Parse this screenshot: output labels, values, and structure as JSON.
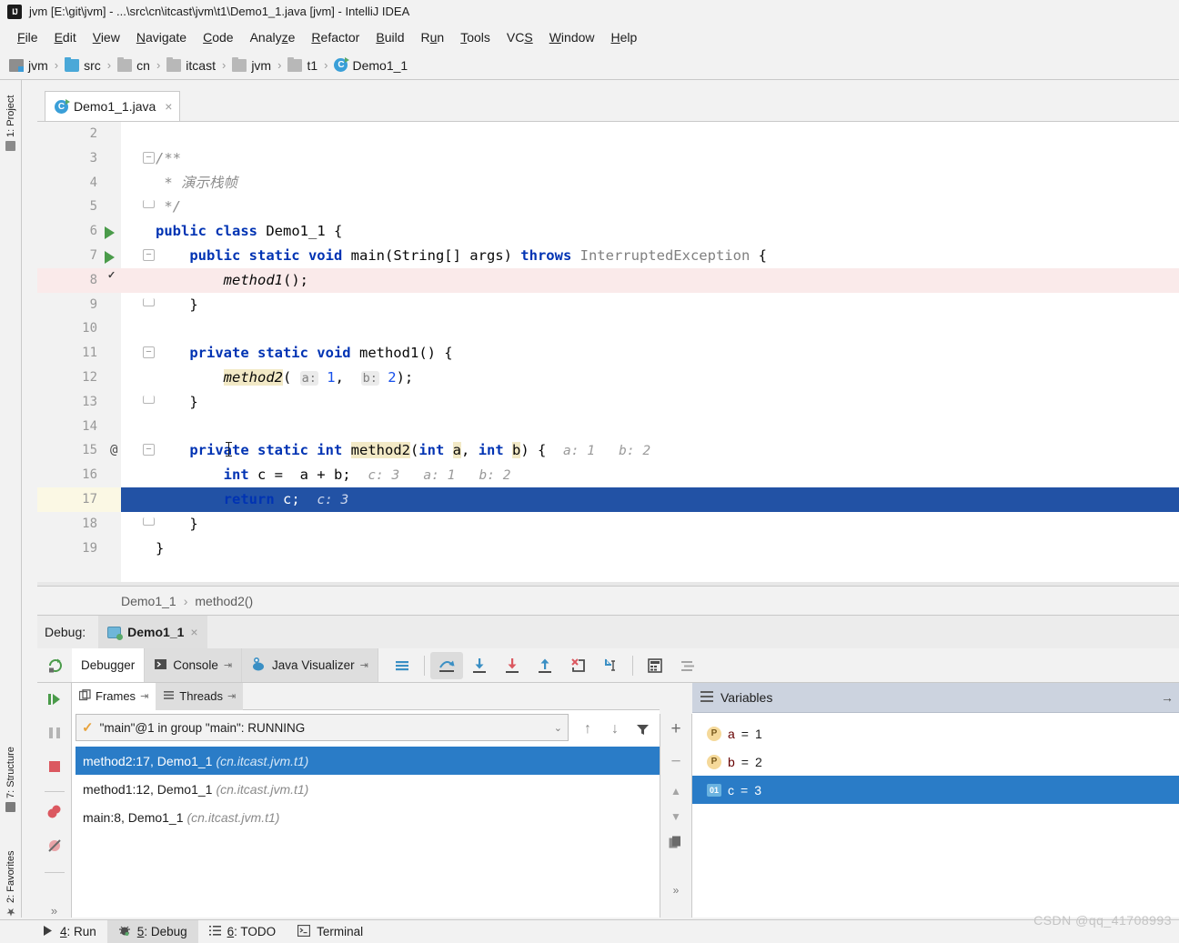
{
  "window": {
    "title": "jvm [E:\\git\\jvm] - ...\\src\\cn\\itcast\\jvm\\t1\\Demo1_1.java [jvm] - IntelliJ IDEA",
    "logo": "intellij-idea-logo"
  },
  "menu": [
    {
      "label": "File",
      "mnemonic": "F"
    },
    {
      "label": "Edit",
      "mnemonic": "E"
    },
    {
      "label": "View",
      "mnemonic": "V"
    },
    {
      "label": "Navigate",
      "mnemonic": "N"
    },
    {
      "label": "Code",
      "mnemonic": "C"
    },
    {
      "label": "Analyze",
      "mnemonic": "z"
    },
    {
      "label": "Refactor",
      "mnemonic": "R"
    },
    {
      "label": "Build",
      "mnemonic": "B"
    },
    {
      "label": "Run",
      "mnemonic": "u"
    },
    {
      "label": "Tools",
      "mnemonic": "T"
    },
    {
      "label": "VCS",
      "mnemonic": "S"
    },
    {
      "label": "Window",
      "mnemonic": "W"
    },
    {
      "label": "Help",
      "mnemonic": "H"
    }
  ],
  "breadcrumb": [
    {
      "label": "jvm",
      "icon": "module-icon"
    },
    {
      "label": "src",
      "icon": "source-folder-icon"
    },
    {
      "label": "cn",
      "icon": "package-icon"
    },
    {
      "label": "itcast",
      "icon": "package-icon"
    },
    {
      "label": "jvm",
      "icon": "package-icon"
    },
    {
      "label": "t1",
      "icon": "package-icon"
    },
    {
      "label": "Demo1_1",
      "icon": "java-class-icon"
    }
  ],
  "left_rail": [
    {
      "label": "1: Project",
      "num": "1",
      "name": "Project",
      "icon": "project-folder-icon"
    },
    {
      "label": "7: Structure",
      "num": "7",
      "name": "Structure",
      "icon": "structure-icon"
    },
    {
      "label": "2: Favorites",
      "num": "2",
      "name": "Favorites",
      "icon": "star-icon"
    }
  ],
  "editor": {
    "tab": {
      "label": "Demo1_1.java",
      "icon": "java-class-run-icon",
      "close": "×"
    },
    "breadcrumb": {
      "class": "Demo1_1",
      "separator": "›",
      "method": "method2()"
    },
    "lines": [
      {
        "n": "2",
        "html": "",
        "state": "normal"
      },
      {
        "n": "3",
        "html": "<span class='cmt'>/**</span>",
        "state": "normal",
        "fold": "minus"
      },
      {
        "n": "4",
        "html": "<span class='cmt'> * 演示栈帧</span>",
        "state": "normal"
      },
      {
        "n": "5",
        "html": "<span class='cmt'> */</span>",
        "state": "normal",
        "fold": "end"
      },
      {
        "n": "6",
        "html": "<span class='kw'>public class</span> <span class='cls'>Demo1_1</span> {",
        "state": "normal",
        "gutter": "run"
      },
      {
        "n": "7",
        "html": "    <span class='kw'>public static void</span> <span class='mth'>main</span>(String[] args) <span class='kw'>throws</span> <span class='exc'>InterruptedException</span> {",
        "state": "normal",
        "gutter": "run",
        "fold": "minus"
      },
      {
        "n": "8",
        "html": "        <span class='ital'>method1</span>();",
        "state": "breakpoint",
        "gutter": "breakpoint"
      },
      {
        "n": "9",
        "html": "    }",
        "state": "normal",
        "fold": "end"
      },
      {
        "n": "10",
        "html": "",
        "state": "normal"
      },
      {
        "n": "11",
        "html": "    <span class='kw'>private static void</span> <span class='mth'>method1</span>() {",
        "state": "normal",
        "fold": "minus"
      },
      {
        "n": "12",
        "html": "        <span class='ital mth-hl'>method2</span>( <span class='hint'>a:</span> <span class='num'>1</span>,  <span class='hint'>b:</span> <span class='num'>2</span>);",
        "state": "normal"
      },
      {
        "n": "13",
        "html": "    }",
        "state": "normal",
        "fold": "end"
      },
      {
        "n": "14",
        "html": "",
        "state": "normal"
      },
      {
        "n": "15",
        "html": "    <span class='kw'>private static int</span> <span class='mth-hl'>method2</span>(<span class='kw'>int</span> <span class='param-hl'>a</span>, <span class='kw'>int</span> <span class='param-hl'>b</span>) {  <span class='inl'>a: 1   b: 2</span>",
        "state": "normal",
        "annotation": "@",
        "fold": "minus"
      },
      {
        "n": "16",
        "html": "        <span class='kw'>int</span> c =  a + b;  <span class='inl'>c: 3   a: 1   b: 2</span>",
        "state": "normal"
      },
      {
        "n": "17",
        "html": "        <span class='kw'>return</span> c;  <span class='inl'>c: 3</span>",
        "state": "executing"
      },
      {
        "n": "18",
        "html": "    }",
        "state": "normal",
        "fold": "end"
      },
      {
        "n": "19",
        "html": "}",
        "state": "normal"
      }
    ]
  },
  "debug": {
    "label": "Debug:",
    "config_tab": {
      "label": "Demo1_1",
      "icon": "run-config-icon",
      "close": "×"
    },
    "rerun_icon": "rerun-icon",
    "subtabs": [
      {
        "label": "Debugger",
        "active": true,
        "icon": null,
        "pin": false
      },
      {
        "label": "Console",
        "active": false,
        "icon": "console-icon",
        "pin": true
      },
      {
        "label": "Java Visualizer",
        "active": false,
        "icon": "java-visualizer-icon",
        "pin": true
      }
    ],
    "toolbar_icons": [
      "show-execution-point-icon",
      "step-over-icon",
      "step-into-icon",
      "force-step-into-icon",
      "step-out-icon",
      "drop-frame-icon",
      "run-to-cursor-icon",
      "evaluate-expression-icon",
      "settings-icon"
    ],
    "stepper_icons": [
      "resume-program-icon",
      "pause-program-icon",
      "stop-icon",
      "view-breakpoints-icon",
      "mute-breakpoints-icon",
      "expand-icon"
    ],
    "frames": {
      "tabs": [
        {
          "label": "Frames",
          "active": true,
          "icon": "frames-icon",
          "pin": true
        },
        {
          "label": "Threads",
          "active": false,
          "icon": "threads-icon",
          "pin": true
        }
      ],
      "thread_selector": {
        "value": "\"main\"@1 in group \"main\": RUNNING",
        "check": "✓"
      },
      "nav_icons": [
        "arrow-up-icon",
        "arrow-down-icon",
        "filter-icon"
      ],
      "items": [
        {
          "frame": "method2:17, Demo1_1",
          "package": "(cn.itcast.jvm.t1)",
          "selected": true
        },
        {
          "frame": "method1:12, Demo1_1",
          "package": "(cn.itcast.jvm.t1)",
          "selected": false
        },
        {
          "frame": "main:8, Demo1_1",
          "package": "(cn.itcast.jvm.t1)",
          "selected": false
        }
      ]
    },
    "variables": {
      "title": "Variables",
      "header_icon": "list-icon",
      "expand_icon": "→",
      "side_icons": [
        "add-icon",
        "remove-icon",
        "move-up-icon",
        "move-down-icon",
        "copy-icon",
        "expand-icon"
      ],
      "items": [
        {
          "badge": "P",
          "badge_type": "parameter",
          "name": "a",
          "eq": "=",
          "value": "1",
          "selected": false
        },
        {
          "badge": "P",
          "badge_type": "parameter",
          "name": "b",
          "eq": "=",
          "value": "2",
          "selected": false
        },
        {
          "badge": "01",
          "badge_type": "local",
          "name": "c",
          "eq": "=",
          "value": "3",
          "selected": true
        }
      ]
    }
  },
  "statusbar": [
    {
      "label": "4: Run",
      "num": "4",
      "name": "Run",
      "icon": "run-icon",
      "active": false
    },
    {
      "label": "5: Debug",
      "num": "5",
      "name": "Debug",
      "icon": "debug-bug-icon",
      "active": true
    },
    {
      "label": "6: TODO",
      "num": "6",
      "name": "TODO",
      "icon": "todo-icon",
      "active": false
    },
    {
      "label": "Terminal",
      "num": "",
      "name": "Terminal",
      "icon": "terminal-icon",
      "active": false
    }
  ],
  "watermark": "CSDN @qq_41708993",
  "colors": {
    "accent_blue": "#2a7cc7",
    "exec_line": "#2252a5",
    "breakpoint_red": "#db5860",
    "keyword_blue": "#0033b3",
    "vars_header": "#ccd3df",
    "chrome_gray": "#f2f2f2"
  }
}
